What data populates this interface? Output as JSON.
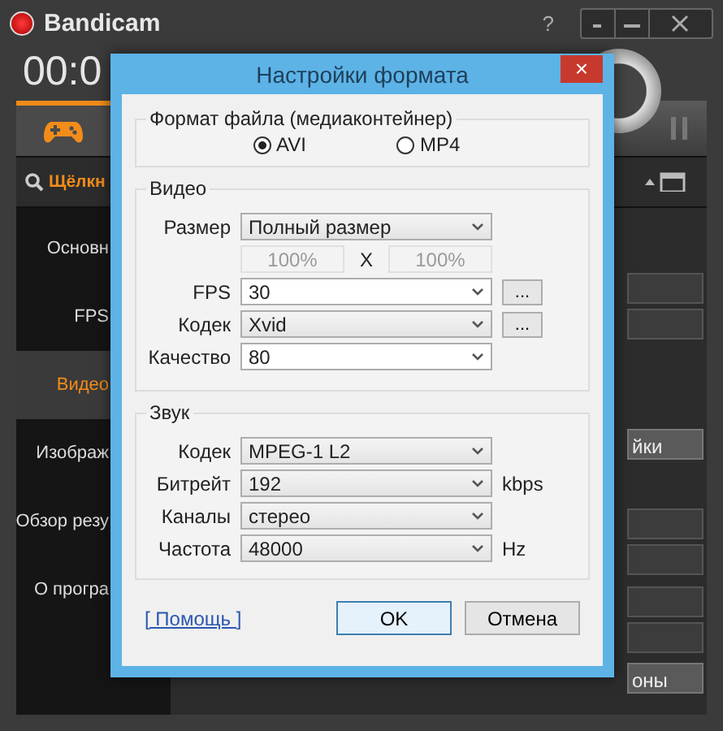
{
  "app": {
    "title": "Bandicam",
    "help": "?",
    "timer": "00:0",
    "search_label": "Щёлкн",
    "sidebar": [
      {
        "label": "Основн",
        "selected": false
      },
      {
        "label": "FPS",
        "selected": false
      },
      {
        "label": "Видео",
        "selected": true
      },
      {
        "label": "Изображ",
        "selected": false
      },
      {
        "label": "Обзор резу",
        "selected": false
      },
      {
        "label": "О програ",
        "selected": false
      }
    ],
    "right_buttons": [
      "йки",
      "оны"
    ]
  },
  "dialog": {
    "title": "Настройки формата",
    "close": "×",
    "container": {
      "title": "Формат файла (медиаконтейнер)",
      "options": [
        {
          "label": "AVI",
          "selected": true
        },
        {
          "label": "MP4",
          "selected": false
        }
      ]
    },
    "video": {
      "title": "Видео",
      "rows": [
        {
          "kind": "select",
          "label": "Размер",
          "value": "Полный размер",
          "editable": false
        },
        {
          "kind": "scale",
          "values": [
            "100%",
            "100%"
          ],
          "separator": "X",
          "disabled": true
        },
        {
          "kind": "select",
          "label": "FPS",
          "value": "30",
          "editable": true,
          "more": "..."
        },
        {
          "kind": "select",
          "label": "Кодек",
          "value": "Xvid",
          "editable": false,
          "more": "..."
        },
        {
          "kind": "select",
          "label": "Качество",
          "value": "80",
          "editable": true
        }
      ]
    },
    "audio": {
      "title": "Звук",
      "rows": [
        {
          "kind": "select",
          "label": "Кодек",
          "value": "MPEG-1 L2",
          "editable": false
        },
        {
          "kind": "select",
          "label": "Битрейт",
          "value": "192",
          "editable": false,
          "unit": "kbps"
        },
        {
          "kind": "select",
          "label": "Каналы",
          "value": "стерео",
          "editable": false
        },
        {
          "kind": "select",
          "label": "Частота",
          "value": "48000",
          "editable": false,
          "unit": "Hz"
        }
      ]
    },
    "help_link": "[ Помощь ]",
    "buttons": [
      {
        "label": "OK",
        "focused": true
      },
      {
        "label": "Отмена",
        "focused": false
      }
    ]
  }
}
